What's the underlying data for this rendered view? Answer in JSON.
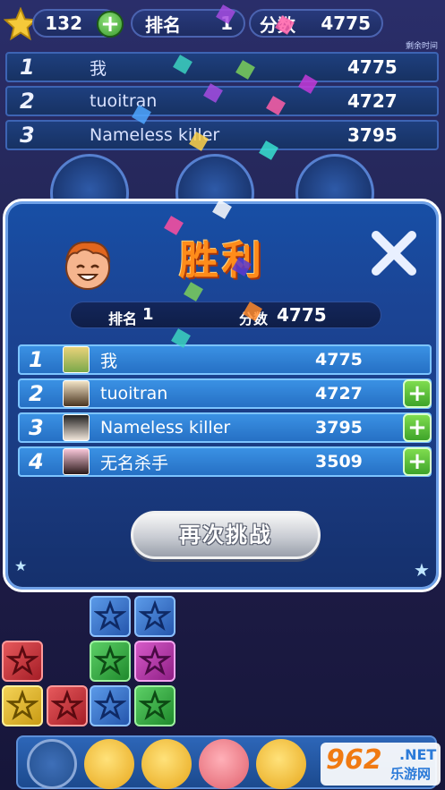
{
  "topbar": {
    "coins": "132",
    "rank_label": "排名",
    "rank_value": "1",
    "score_label": "分数",
    "score_value": "4775",
    "remaining_time_label": "剩余时间"
  },
  "background_board": {
    "rows": [
      {
        "rank": "1",
        "name": "我",
        "score": "4775"
      },
      {
        "rank": "2",
        "name": "tuoitran",
        "score": "4727"
      },
      {
        "rank": "3",
        "name": "Nameless killer",
        "score": "3795"
      }
    ]
  },
  "dialog": {
    "title": "胜利",
    "summary": {
      "rank_label": "排名",
      "rank_value": "1",
      "score_label": "分数",
      "score_value": "4775"
    },
    "rows": [
      {
        "rank": "1",
        "name": "我",
        "score": "4775",
        "avatar": "avatar-blonde-glasses",
        "addable": false
      },
      {
        "rank": "2",
        "name": "tuoitran",
        "score": "4727",
        "avatar": "avatar-bearded-man",
        "addable": true
      },
      {
        "rank": "3",
        "name": "Nameless killer",
        "score": "3795",
        "avatar": "avatar-dark-hair",
        "addable": true
      },
      {
        "rank": "4",
        "name": "无名杀手",
        "score": "3509",
        "avatar": "avatar-pink-girl",
        "addable": true
      }
    ],
    "add_friend_symbol": "+",
    "retry_label": "再次挑战"
  },
  "watermark": {
    "number": "962",
    "net": ".NET",
    "site": "乐游网"
  },
  "colors": {
    "title_orange": "#ff8c1a",
    "dialog_blue": "#1b4596",
    "row_blue": "#2f80d6",
    "add_green": "#4cb832"
  }
}
